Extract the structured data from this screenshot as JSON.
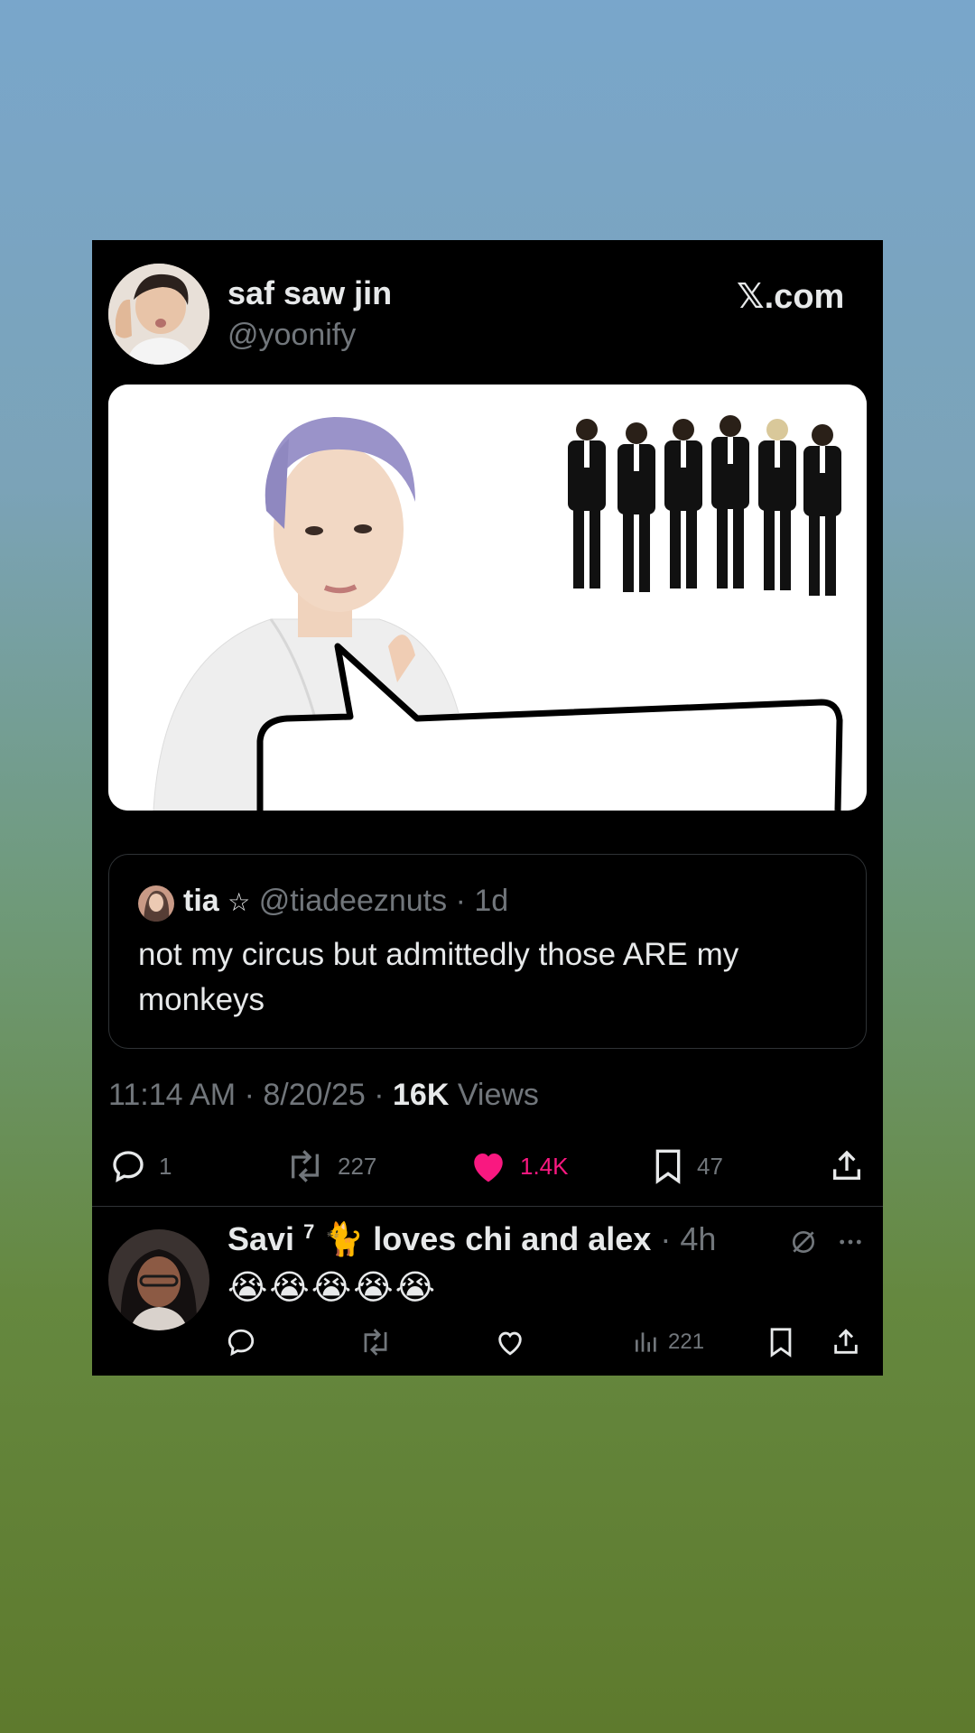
{
  "tweet": {
    "display_name": "saf saw jin",
    "handle": "@yoonify",
    "source": ".com",
    "source_icon": "x-logo-icon",
    "quote": {
      "name": "tia",
      "badge": "☆",
      "handle": "@tiadeeznuts",
      "time": "· 1d",
      "text": "not my circus but admittedly those ARE my monkeys"
    },
    "meta": {
      "time": "11:14 AM · 8/20/25 · ",
      "views_count": "16K",
      "views_label": " Views"
    },
    "actions": {
      "replies": "1",
      "reposts": "227",
      "likes": "1.4K",
      "bookmarks": "47"
    },
    "like_color": "#f91880"
  },
  "reply": {
    "name_prefix": "Savi",
    "superscript": "7",
    "name_emoji": "🐈",
    "name_suffix": "loves chi and alex",
    "time": "· 4h",
    "text": "😭😭😭😭😭",
    "views": "221"
  }
}
